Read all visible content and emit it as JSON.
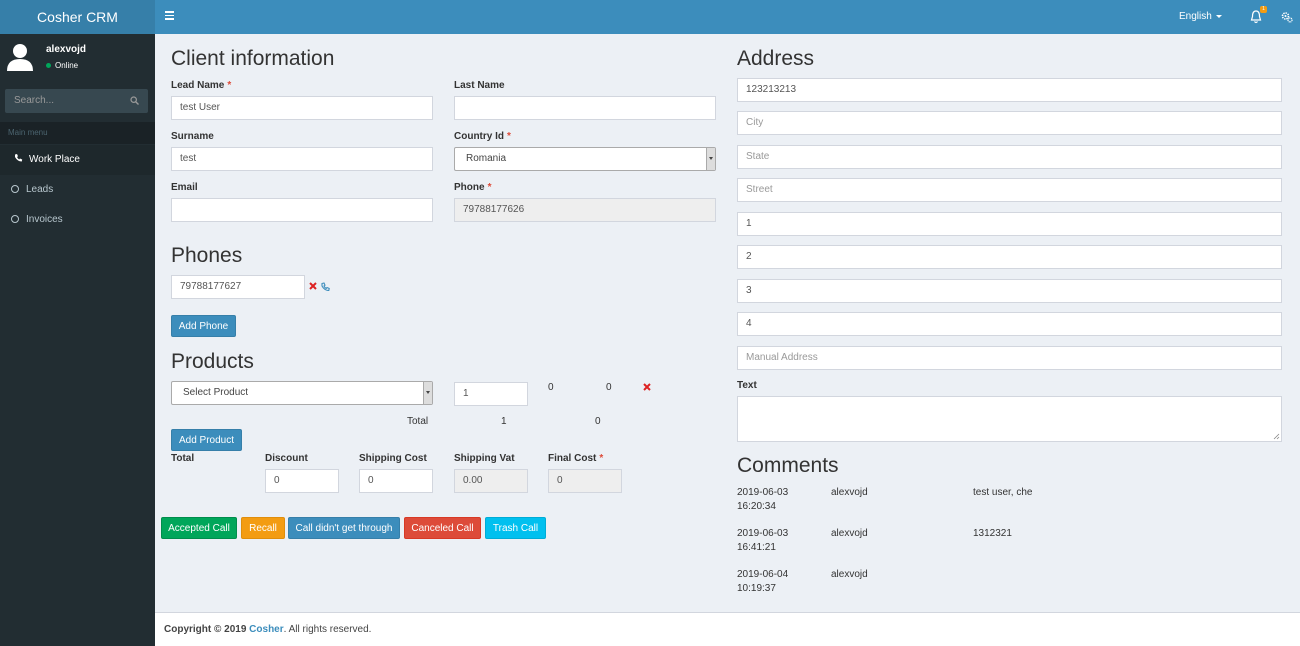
{
  "app": {
    "title": "Cosher CRM"
  },
  "topbar": {
    "language": "English",
    "notifications_count": "1"
  },
  "user": {
    "name": "alexvojd",
    "status": "Online"
  },
  "sidebar": {
    "search_placeholder": "Search...",
    "menu_header": "Main menu",
    "items": [
      {
        "label": "Work Place",
        "icon": "phone-icon"
      },
      {
        "label": "Leads",
        "icon": "circle-icon"
      },
      {
        "label": "Invoices",
        "icon": "circle-icon"
      }
    ]
  },
  "client": {
    "heading": "Client information",
    "lead_name_label": "Lead Name",
    "lead_name_value": "test User",
    "last_name_label": "Last Name",
    "last_name_value": "",
    "surname_label": "Surname",
    "surname_value": "test",
    "country_label": "Country Id",
    "country_value": "Romania",
    "email_label": "Email",
    "email_value": "",
    "phone_label": "Phone",
    "phone_value": "79788177626"
  },
  "phones": {
    "heading": "Phones",
    "items": [
      "79788177627"
    ],
    "add_label": "Add Phone"
  },
  "products": {
    "heading": "Products",
    "select_placeholder": "Select Product",
    "quantity": "1",
    "price": "0",
    "cost": "0",
    "total_label": "Total",
    "total_quantity": "1",
    "total_cost": "0",
    "add_label": "Add Product"
  },
  "summary": {
    "total_label": "Total",
    "discount_label": "Discount",
    "discount_value": "0",
    "shipping_cost_label": "Shipping Cost",
    "shipping_cost_value": "0",
    "shipping_vat_label": "Shipping Vat",
    "shipping_vat_value": "0.00",
    "final_cost_label": "Final Cost",
    "final_cost_value": "0"
  },
  "actions": {
    "accepted": "Accepted Call",
    "recall": "Recall",
    "no_answer": "Call didn't get through",
    "canceled": "Canceled Call",
    "trash": "Trash Call"
  },
  "address": {
    "heading": "Address",
    "fields": [
      {
        "value": "123213213",
        "placeholder": ""
      },
      {
        "value": "",
        "placeholder": "City"
      },
      {
        "value": "",
        "placeholder": "State"
      },
      {
        "value": "",
        "placeholder": "Street"
      },
      {
        "value": "1",
        "placeholder": ""
      },
      {
        "value": "2",
        "placeholder": ""
      },
      {
        "value": "3",
        "placeholder": ""
      },
      {
        "value": "4",
        "placeholder": ""
      },
      {
        "value": "",
        "placeholder": "Manual Address"
      }
    ],
    "text_label": "Text",
    "text_value": ""
  },
  "comments": {
    "heading": "Comments",
    "items": [
      {
        "date": "2019-06-03",
        "time": "16:20:34",
        "author": "alexvojd",
        "text": "test user, che"
      },
      {
        "date": "2019-06-03",
        "time": "16:41:21",
        "author": "alexvojd",
        "text": "1312321"
      },
      {
        "date": "2019-06-04",
        "time": "10:19:37",
        "author": "alexvojd",
        "text": ""
      }
    ]
  },
  "footer": {
    "prefix": "Copyright © 2019",
    "brand": "Cosher",
    "suffix": ". All rights reserved."
  },
  "colors": {
    "header": "#3c8dbc",
    "logo": "#367fa9",
    "sidebar": "#222d32",
    "success": "#00a65a",
    "warning": "#f39c12",
    "danger": "#dd4b39",
    "info": "#00c0ef"
  }
}
